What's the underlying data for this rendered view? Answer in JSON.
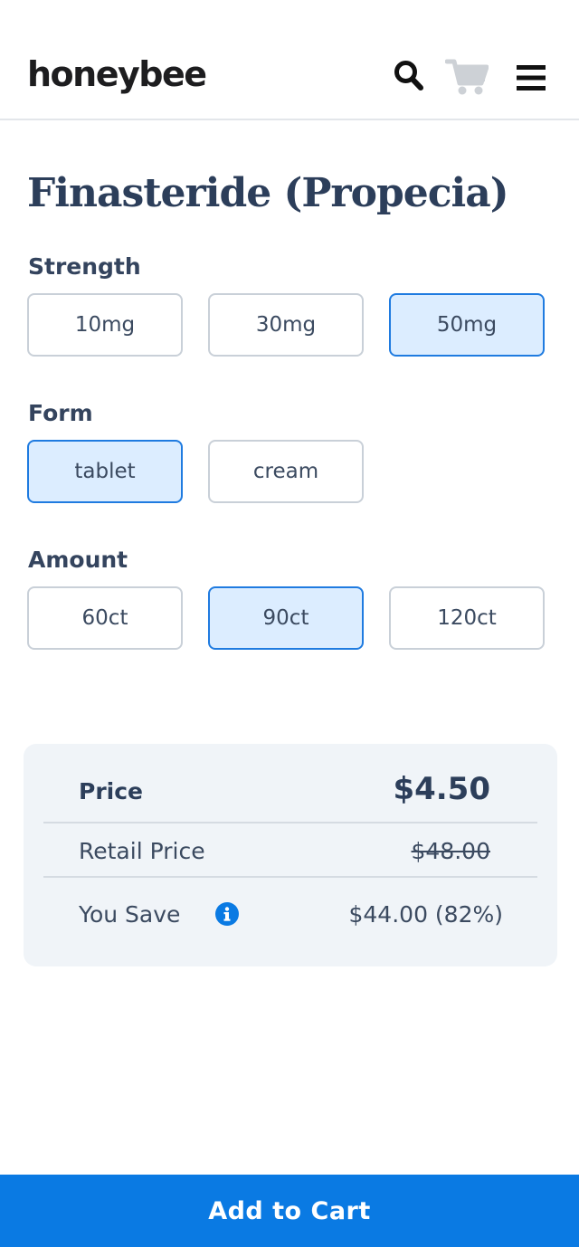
{
  "header": {
    "logo": "honeybee",
    "icons": [
      "search-icon",
      "cart-icon",
      "hamburger-menu-icon"
    ]
  },
  "product": {
    "title": "Finasteride (Propecia)"
  },
  "options": {
    "strength": {
      "label": "Strength",
      "items": [
        "10mg",
        "30mg",
        "50mg"
      ],
      "selected": "50mg"
    },
    "form": {
      "label": "Form",
      "items": [
        "tablet",
        "cream"
      ],
      "selected": "tablet"
    },
    "amount": {
      "label": "Amount",
      "items": [
        "60ct",
        "90ct",
        "120ct"
      ],
      "selected": "90ct"
    }
  },
  "pricing": {
    "price_label": "Price",
    "price_value": "$4.50",
    "retail_label": "Retail Price",
    "retail_value": "$48.00",
    "save_label": "You Save",
    "save_value": "$44.00 (82%)"
  },
  "cta": {
    "label": "Add to Cart"
  },
  "colors": {
    "accent": "#0a7ae3",
    "selected_bg": "#dcedff",
    "card_bg": "#f0f4f8",
    "text": "#2c3e5a"
  }
}
